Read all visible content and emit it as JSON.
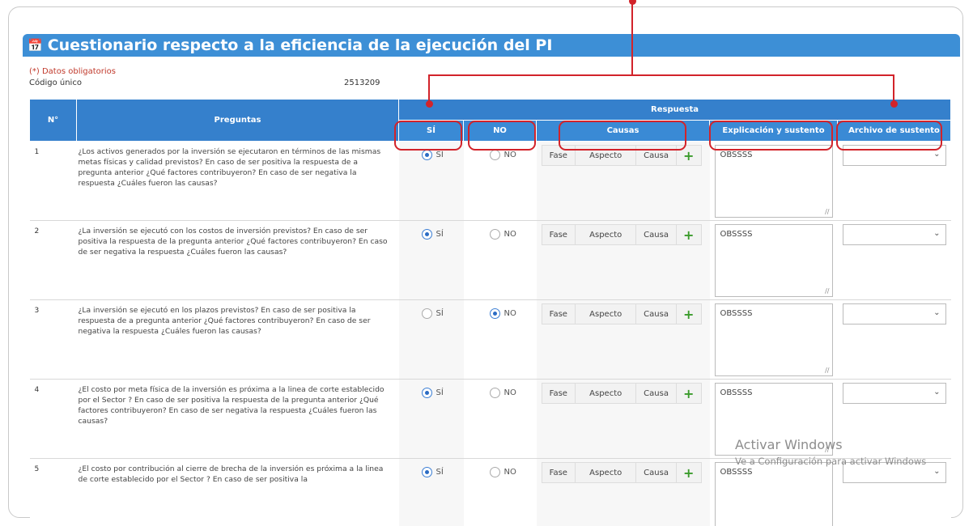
{
  "header": {
    "icon": "calendar-icon",
    "title": "Cuestionario respecto a la eficiencia de la ejecución del PI"
  },
  "form": {
    "required_note": "(*) Datos obligatorios",
    "code_label": "Código único",
    "code_value": "2513209"
  },
  "table": {
    "col_num": "N°",
    "col_questions": "Preguntas",
    "col_response": "Respuesta",
    "col_si": "SÍ",
    "col_no": "NO",
    "col_causes": "Causas",
    "col_explain": "Explicación y sustento",
    "col_file": "Archivo de sustento",
    "radio_si": "SÍ",
    "radio_no": "NO",
    "cause_fase": "Fase",
    "cause_aspecto": "Aspecto",
    "cause_causa": "Causa",
    "rows": [
      {
        "num": "1",
        "question": "¿Los activos generados por la inversión se ejecutaron en términos de las mismas metas físicas y calidad previstos? En caso de ser positiva la respuesta de a pregunta anterior ¿Qué factores contribuyeron? En caso de ser negativa la respuesta ¿Cuáles fueron las causas?",
        "answer": "si",
        "explanation": "OBSSSS"
      },
      {
        "num": "2",
        "question": "¿La inversión se ejecutó con los costos de inversión previstos? En caso de ser positiva la respuesta de la pregunta anterior ¿Qué factores contribuyeron? En caso de ser negativa la respuesta ¿Cuáles fueron las causas?",
        "answer": "si",
        "explanation": "OBSSSS"
      },
      {
        "num": "3",
        "question": "¿La inversión se ejecutó en los plazos previstos? En caso de ser positiva la respuesta de a pregunta anterior ¿Qué factores contribuyeron? En caso de ser negativa la respuesta ¿Cuáles fueron las causas?",
        "answer": "no",
        "explanation": "OBSSSS"
      },
      {
        "num": "4",
        "question": "¿El costo por meta física de la inversión es próxima a la linea de corte establecido por el Sector ? En caso de ser positiva la respuesta de la pregunta anterior ¿Qué factores contribuyeron? En caso de ser negativa la respuesta ¿Cuáles fueron las causas?",
        "answer": "si",
        "explanation": "OBSSSS"
      },
      {
        "num": "5",
        "question": "¿El costo por contribución al cierre de brecha de la inversión es próxima a la linea de corte establecido por el Sector ? En caso de ser positiva la",
        "answer": "si",
        "explanation": "OBSSSS"
      }
    ]
  },
  "watermark": {
    "line1": "Activar Windows",
    "line2": "Ve a Configuración para activar Windows"
  },
  "colors": {
    "header_blue": "#3d8fd6",
    "table_header_blue": "#3580cc",
    "highlight_red": "#d2232a",
    "plus_green": "#3a9b2b"
  }
}
